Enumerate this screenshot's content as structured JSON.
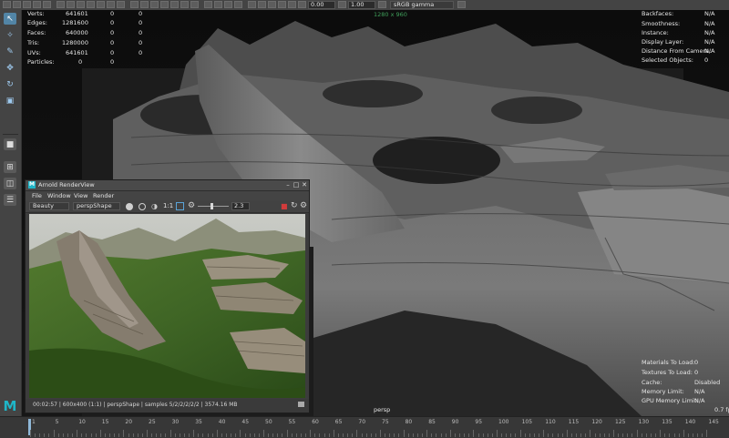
{
  "top_toolbar": {
    "fields": {
      "field_1": "0.00",
      "field_2": "1.00"
    },
    "color_space": "sRGB gamma"
  },
  "viewport": {
    "resolution_gate": "1280 x 960",
    "camera_label": "persp",
    "frame_rate": "0.7 fps",
    "stats_left": [
      {
        "label": "Verts:",
        "v1": "641601",
        "v2": "0",
        "v3": "0"
      },
      {
        "label": "Edges:",
        "v1": "1281600",
        "v2": "0",
        "v3": "0"
      },
      {
        "label": "Faces:",
        "v1": "640000",
        "v2": "0",
        "v3": "0"
      },
      {
        "label": "Tris:",
        "v1": "1280000",
        "v2": "0",
        "v3": "0"
      },
      {
        "label": "UVs:",
        "v1": "641601",
        "v2": "0",
        "v3": "0"
      },
      {
        "label": "Particles:",
        "v1": "0",
        "v2": "0",
        "v3": ""
      }
    ],
    "stats_right": [
      {
        "label": "Backfaces:",
        "value": "N/A"
      },
      {
        "label": "Smoothness:",
        "value": "N/A"
      },
      {
        "label": "Instance:",
        "value": "N/A"
      },
      {
        "label": "Display Layer:",
        "value": "N/A"
      },
      {
        "label": "Distance From Camera:",
        "value": "N/A"
      },
      {
        "label": "Selected Objects:",
        "value": "0"
      }
    ],
    "stats_bottom": [
      {
        "label": "Materials To Load:",
        "value": "0"
      },
      {
        "label": "Textures To Load:",
        "value": "0"
      },
      {
        "label": "Cache:",
        "value": "Disabled"
      },
      {
        "label": "Memory Limit:",
        "value": "N/A"
      },
      {
        "label": "GPU Memory Limit:",
        "value": "N/A"
      }
    ]
  },
  "render_view": {
    "title": "Arnold RenderView",
    "menus": [
      "File",
      "Window",
      "View",
      "Render"
    ],
    "aov": "Beauty",
    "camera": "perspShape",
    "ratio": "1:1",
    "exposure": "2.3",
    "status": "00:02:57 | 600x400 (1:1) | perspShape | samples 5/2/2/2/2/2 | 3574.16 MB"
  },
  "time_slider": {
    "ticks": [
      "1",
      "5",
      "10",
      "15",
      "20",
      "25",
      "30",
      "35",
      "40",
      "45",
      "50",
      "55",
      "60",
      "65",
      "70",
      "75",
      "80",
      "85",
      "90",
      "95",
      "100",
      "105",
      "110",
      "115",
      "120",
      "125",
      "130",
      "135",
      "140",
      "145"
    ]
  },
  "colors": {
    "ui_bg": "#444444",
    "viewport_bg": "#101010",
    "highlight": "#5285a6",
    "maya_logo": "#1fb5c7",
    "gate_label": "#3f9f5a",
    "stop_button": "#d23b3b"
  }
}
